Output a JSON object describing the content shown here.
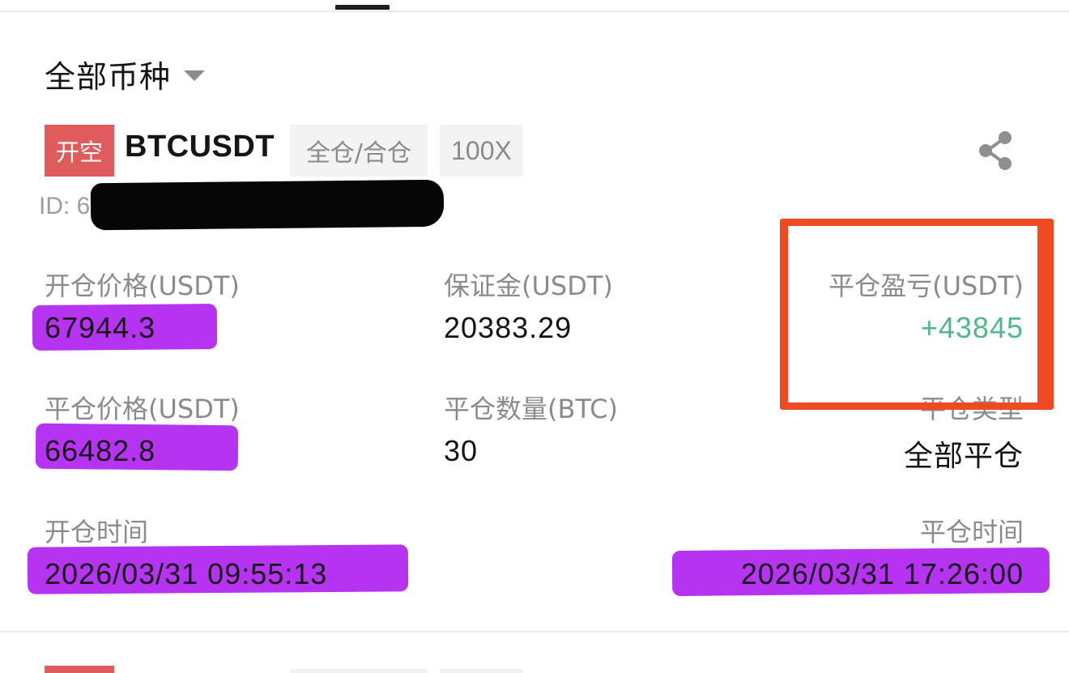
{
  "filter": {
    "label": "全部币种"
  },
  "position": {
    "side_tag": "开空",
    "symbol": "BTCUSDT",
    "margin_mode": "全仓/合仓",
    "leverage": "100X",
    "id_label": "ID: 6"
  },
  "fields": {
    "open_price": {
      "label": "开仓价格(USDT)",
      "value": "67944.3"
    },
    "margin": {
      "label": "保证金(USDT)",
      "value": "20383.29"
    },
    "pnl": {
      "label": "平仓盈亏(USDT)",
      "value": "+43845"
    },
    "close_price": {
      "label": "平仓价格(USDT)",
      "value": "66482.8"
    },
    "close_qty": {
      "label": "平仓数量(BTC)",
      "value": "30"
    },
    "close_type": {
      "label": "平仓类型",
      "value": "全部平仓"
    },
    "open_time": {
      "label": "开仓时间",
      "value": "2026/03/31 09:55:13"
    },
    "close_time": {
      "label": "平仓时间",
      "value": "2026/03/31 17:26:00"
    }
  },
  "colors": {
    "short_tag": "#e05b5b",
    "profit": "#4fb889",
    "highlighter": "#b733f2",
    "annotation_box": "#f04a22"
  },
  "icons": {
    "share": "share-icon",
    "dropdown": "caret-down-icon"
  }
}
